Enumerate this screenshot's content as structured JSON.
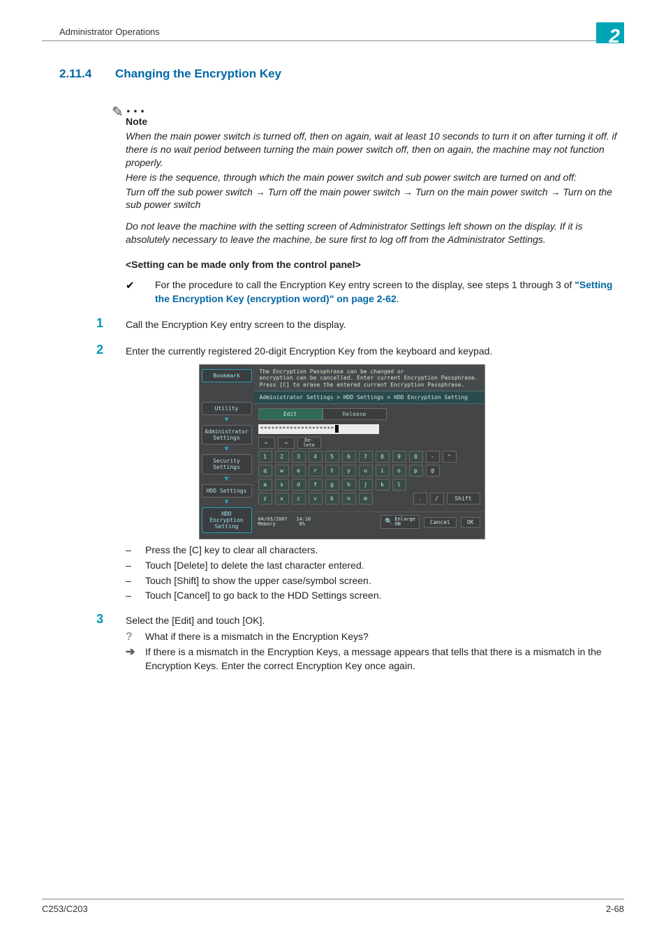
{
  "header": {
    "section_title": "Administrator Operations",
    "chapter_number": "2"
  },
  "section": {
    "number": "2.11.4",
    "title": "Changing the Encryption Key"
  },
  "note": {
    "label": "Note",
    "p1": "When the main power switch is turned off, then on again, wait at least 10 seconds to turn it on after turning it off. if there is no wait period between turning the main power switch off, then on again, the machine may not function properly.",
    "p2": "Here is the sequence, through which the main power switch and sub power switch are turned on and off:",
    "p3": "Turn off the sub power switch → Turn off the main power switch → Turn on the main power switch → Turn on the sub power switch",
    "p4": "Do not leave the machine with the setting screen of Administrator Settings left shown on the display. If it is absolutely necessary to leave the machine, be sure first to log off from the Administrator Settings."
  },
  "setting_heading": "<Setting can be made only from the control panel>",
  "check": {
    "mark": "✔",
    "text_before": "For the procedure to call the Encryption Key entry screen to the display, see steps 1 through 3 of ",
    "link_text": "\"Setting the Encryption Key (encryption word)\" on page 2-62",
    "text_after": "."
  },
  "steps": {
    "s1": {
      "num": "1",
      "text": "Call the Encryption Key entry screen to the display."
    },
    "s2": {
      "num": "2",
      "text": "Enter the currently registered 20-digit Encryption Key from the keyboard and keypad."
    },
    "s3": {
      "num": "3",
      "text": "Select the [Edit] and touch [OK]."
    }
  },
  "dashes": {
    "d1": "Press the [C] key to clear all characters.",
    "d2": "Touch [Delete] to delete the last character entered.",
    "d3": "Touch [Shift] to show the upper case/symbol screen.",
    "d4": "Touch [Cancel] to go back to the HDD Settings screen."
  },
  "qa": {
    "q_mark": "?",
    "q_text": "What if there is a mismatch in the Encryption Keys?",
    "a_mark": "➔",
    "a_text": "If there is a mismatch in the Encryption Keys, a message appears that tells that there is a mismatch in the Encryption Keys. Enter the correct Encryption Key once again."
  },
  "panel": {
    "msg_l1": "The Encryption Passphrase can be changed or",
    "msg_l2": "encryption can be cancelled. Enter current Encryption Passphrase.",
    "msg_l3": "Press [C] to erase the entered current Encryption Passphrase.",
    "crumb": "Administrator Settings > HDD Settings > HDD Encryption Setting",
    "tabs": {
      "edit": "Edit",
      "release": "Release"
    },
    "input_masked": "********************",
    "side": {
      "bookmark": "Bookmark",
      "utility": "Utility",
      "admin": "Administrator\nSettings",
      "security": "Security\nSettings",
      "hdd": "HDD Settings",
      "enc": "HDD Encryption\nSetting"
    },
    "keys": {
      "delete": "De-\nlete",
      "row1": [
        "1",
        "2",
        "3",
        "4",
        "5",
        "6",
        "7",
        "8",
        "9",
        "0",
        "-",
        "^"
      ],
      "row2": [
        "q",
        "w",
        "e",
        "r",
        "t",
        "y",
        "u",
        "i",
        "o",
        "p",
        "@"
      ],
      "row3": [
        "a",
        "s",
        "d",
        "f",
        "g",
        "h",
        "j",
        "k",
        "l"
      ],
      "row4": [
        "z",
        "x",
        "c",
        "v",
        "b",
        "n",
        "m"
      ],
      "sym1": ".",
      "sym2": "/",
      "shift": "Shift"
    },
    "footer": {
      "date": "04/03/2007",
      "time": "14:16",
      "mem_label": "Memory",
      "mem_val": "0%",
      "enlarge": "Enlarge\nON",
      "cancel": "Cancel",
      "ok": "OK"
    }
  },
  "footer": {
    "left": "C253/C203",
    "right": "2-68"
  }
}
